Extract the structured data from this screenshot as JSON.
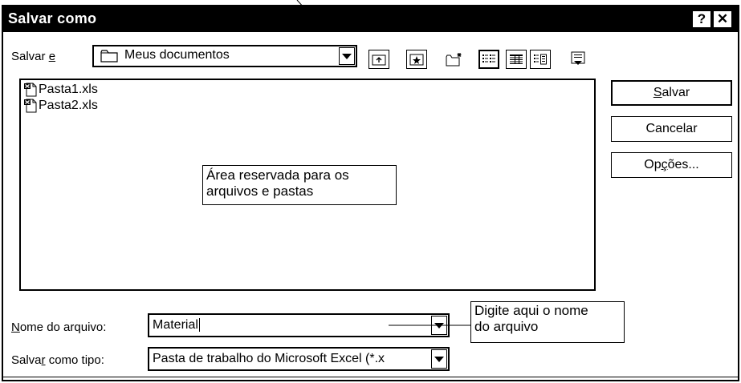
{
  "window": {
    "title": "Salvar como",
    "help_button": "?",
    "close_button": "✕"
  },
  "location": {
    "label_prefix": "Salvar ",
    "label_accel": "e",
    "folder": "Meus documentos",
    "folder_icon": "folder-icon"
  },
  "toolbar": {
    "buttons": [
      {
        "name": "up-one-level-button",
        "icon": "up-folder-icon"
      },
      {
        "name": "favorites-button",
        "icon": "favorites-icon"
      },
      {
        "name": "new-folder-button",
        "icon": "new-folder-icon"
      },
      {
        "name": "list-view-button",
        "icon": "list-icon"
      },
      {
        "name": "details-view-button",
        "icon": "details-icon"
      },
      {
        "name": "properties-view-button",
        "icon": "properties-icon"
      },
      {
        "name": "commands-button",
        "icon": "commands-icon"
      }
    ]
  },
  "files": [
    {
      "name": "Pasta1.xls",
      "icon": "excel-file-icon"
    },
    {
      "name": "Pasta2.xls",
      "icon": "excel-file-icon"
    }
  ],
  "annotations": {
    "file_area": "Área reservada para os arquivos e pastas",
    "file_area_line1": "Área reservada para os",
    "file_area_line2": "arquivos e pastas",
    "filename_line1": "Digite aqui o nome",
    "filename_line2": "do arquivo"
  },
  "filename": {
    "label_accel": "N",
    "label_rest": "ome do arquivo:",
    "value": "Material"
  },
  "filetype": {
    "label_prefix": "Salva",
    "label_accel": "r",
    "label_rest": " como tipo:",
    "value": "Pasta de trabalho do Microsoft Excel (*.x"
  },
  "buttons": {
    "save_accel": "S",
    "save_rest": "alvar",
    "cancel": "Cancelar",
    "options_prefix": "Op",
    "options_accel": "ç",
    "options_rest": "ões..."
  }
}
